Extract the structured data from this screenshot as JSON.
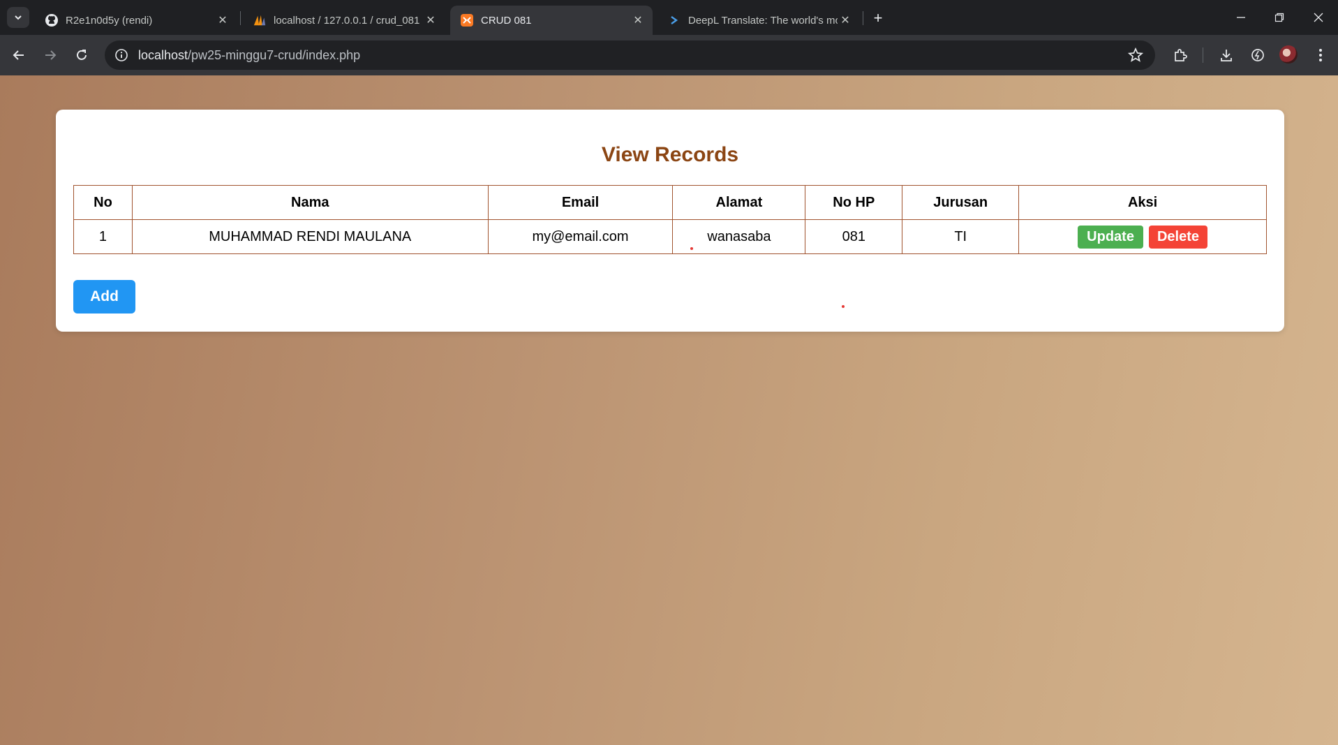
{
  "browser": {
    "tabs": [
      {
        "title": "R2e1n0d5y (rendi)",
        "icon": "github-icon",
        "active": false
      },
      {
        "title": "localhost / 127.0.0.1 / crud_081",
        "icon": "phpmyadmin-icon",
        "active": false
      },
      {
        "title": "CRUD 081",
        "icon": "xampp-icon",
        "active": true
      },
      {
        "title": "DeepL Translate: The world's mo",
        "icon": "deepl-icon",
        "active": false
      }
    ],
    "url_host": "localhost",
    "url_path": "/pw25-minggu7-crud/index.php"
  },
  "page": {
    "heading": "View Records",
    "table": {
      "headers": [
        "No",
        "Nama",
        "Email",
        "Alamat",
        "No HP",
        "Jurusan",
        "Aksi"
      ],
      "rows": [
        {
          "no": "1",
          "nama": "MUHAMMAD RENDI MAULANA",
          "email": "my@email.com",
          "alamat": "wanasaba",
          "no_hp": "081",
          "jurusan": "TI"
        }
      ]
    },
    "update_label": "Update",
    "delete_label": "Delete",
    "add_label": "Add"
  },
  "colors": {
    "heading": "#8b4513",
    "update_button": "#4caf50",
    "delete_button": "#f44336",
    "add_button": "#2196f3"
  }
}
